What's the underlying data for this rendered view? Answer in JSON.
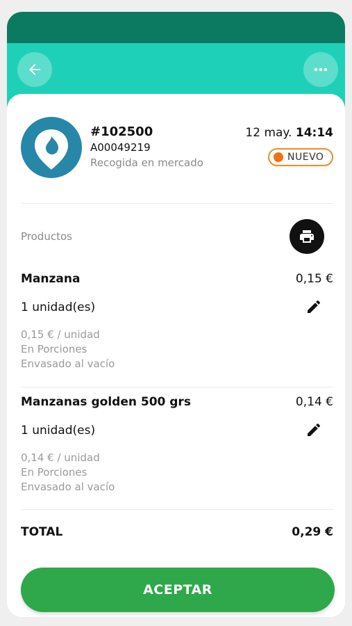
{
  "header": {
    "back_icon": "arrow-left-icon",
    "more_icon": "more-horizontal-icon"
  },
  "order": {
    "number": "#102500",
    "code": "A00049219",
    "delivery": "Recogida en mercado",
    "date": "12 may.",
    "time": "14:14",
    "status": "NUEVO"
  },
  "products": {
    "label": "Productos",
    "print_icon": "printer-icon",
    "items": [
      {
        "name": "Manzana",
        "price": "0,15 €",
        "quantity": "1 unidad(es)",
        "unit_price": "0,15 € / unidad",
        "cut": "En Porciones",
        "packaging": "Envasado al vacío"
      },
      {
        "name": "Manzanas golden 500 grs",
        "price": "0,14 €",
        "quantity": "1 unidad(es)",
        "unit_price": "0,14 € / unidad",
        "cut": "En Porciones",
        "packaging": "Envasado al vacío"
      }
    ]
  },
  "total": {
    "label": "TOTAL",
    "value": "0,29 €"
  },
  "actions": {
    "accept_label": "ACEPTAR"
  },
  "colors": {
    "header_dark": "#0b7a61",
    "header_teal": "#1fd0b8",
    "status_orange": "#f36f12",
    "accept_green": "#2ea84a",
    "logo_blue": "#2787a8"
  }
}
